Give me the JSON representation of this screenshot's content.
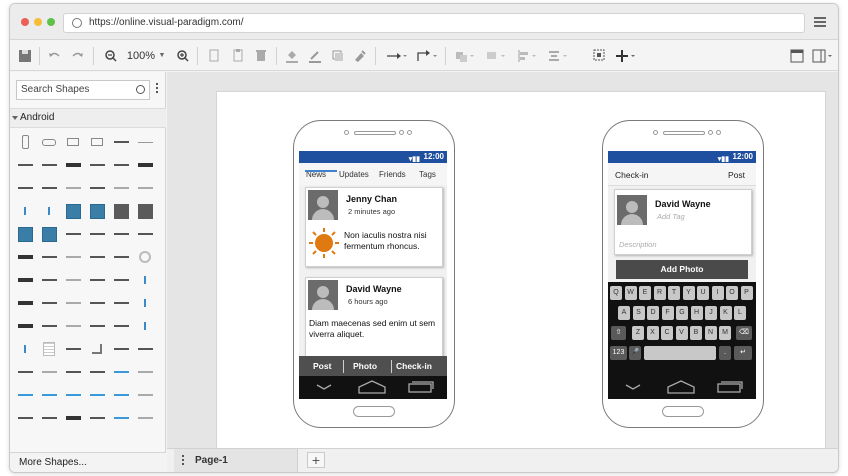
{
  "browser": {
    "url": "https://online.visual-paradigm.com/",
    "traffic_lights": [
      "#ec5f57",
      "#f6bd3b",
      "#5ec248"
    ]
  },
  "toolbar": {
    "zoom_value": "100%"
  },
  "sidebar": {
    "search_placeholder": "Search Shapes",
    "category": "Android",
    "more_shapes": "More Shapes..."
  },
  "pages": {
    "tab_label": "Page-1",
    "add_symbol": "+"
  },
  "phone1": {
    "time": "12:00",
    "tabs": [
      "News",
      "Updates",
      "Friends",
      "Tags"
    ],
    "active_tab": "News",
    "post1": {
      "name": "Jenny Chan",
      "time": "2 minutes ago",
      "text": "Non iaculis nostra nisi fermentum rhoncus."
    },
    "post2": {
      "name": "David Wayne",
      "time": "6 hours ago",
      "text": "Diam maecenas sed enim ut sem viverra aliquet."
    },
    "actions": [
      "Post",
      "Photo",
      "Check-in"
    ]
  },
  "phone2": {
    "time": "12:00",
    "header_left": "Check-in",
    "header_right": "Post",
    "card": {
      "name": "David Wayne",
      "tag_placeholder": "Add Tag",
      "description_placeholder": "Description"
    },
    "add_photo": "Add Photo",
    "keyboard": {
      "row1": [
        "Q",
        "W",
        "E",
        "R",
        "T",
        "Y",
        "U",
        "I",
        "O",
        "P"
      ],
      "row2": [
        "A",
        "S",
        "D",
        "F",
        "G",
        "H",
        "J",
        "K",
        "L"
      ],
      "row3": [
        "Z",
        "X",
        "C",
        "V",
        "B",
        "N",
        "M"
      ],
      "num_key": "123",
      "dot_key": "."
    }
  },
  "colors": {
    "status_bar": "#1f4f9f",
    "tab_accent": "#3f82cf",
    "sun": "#e07a10"
  }
}
